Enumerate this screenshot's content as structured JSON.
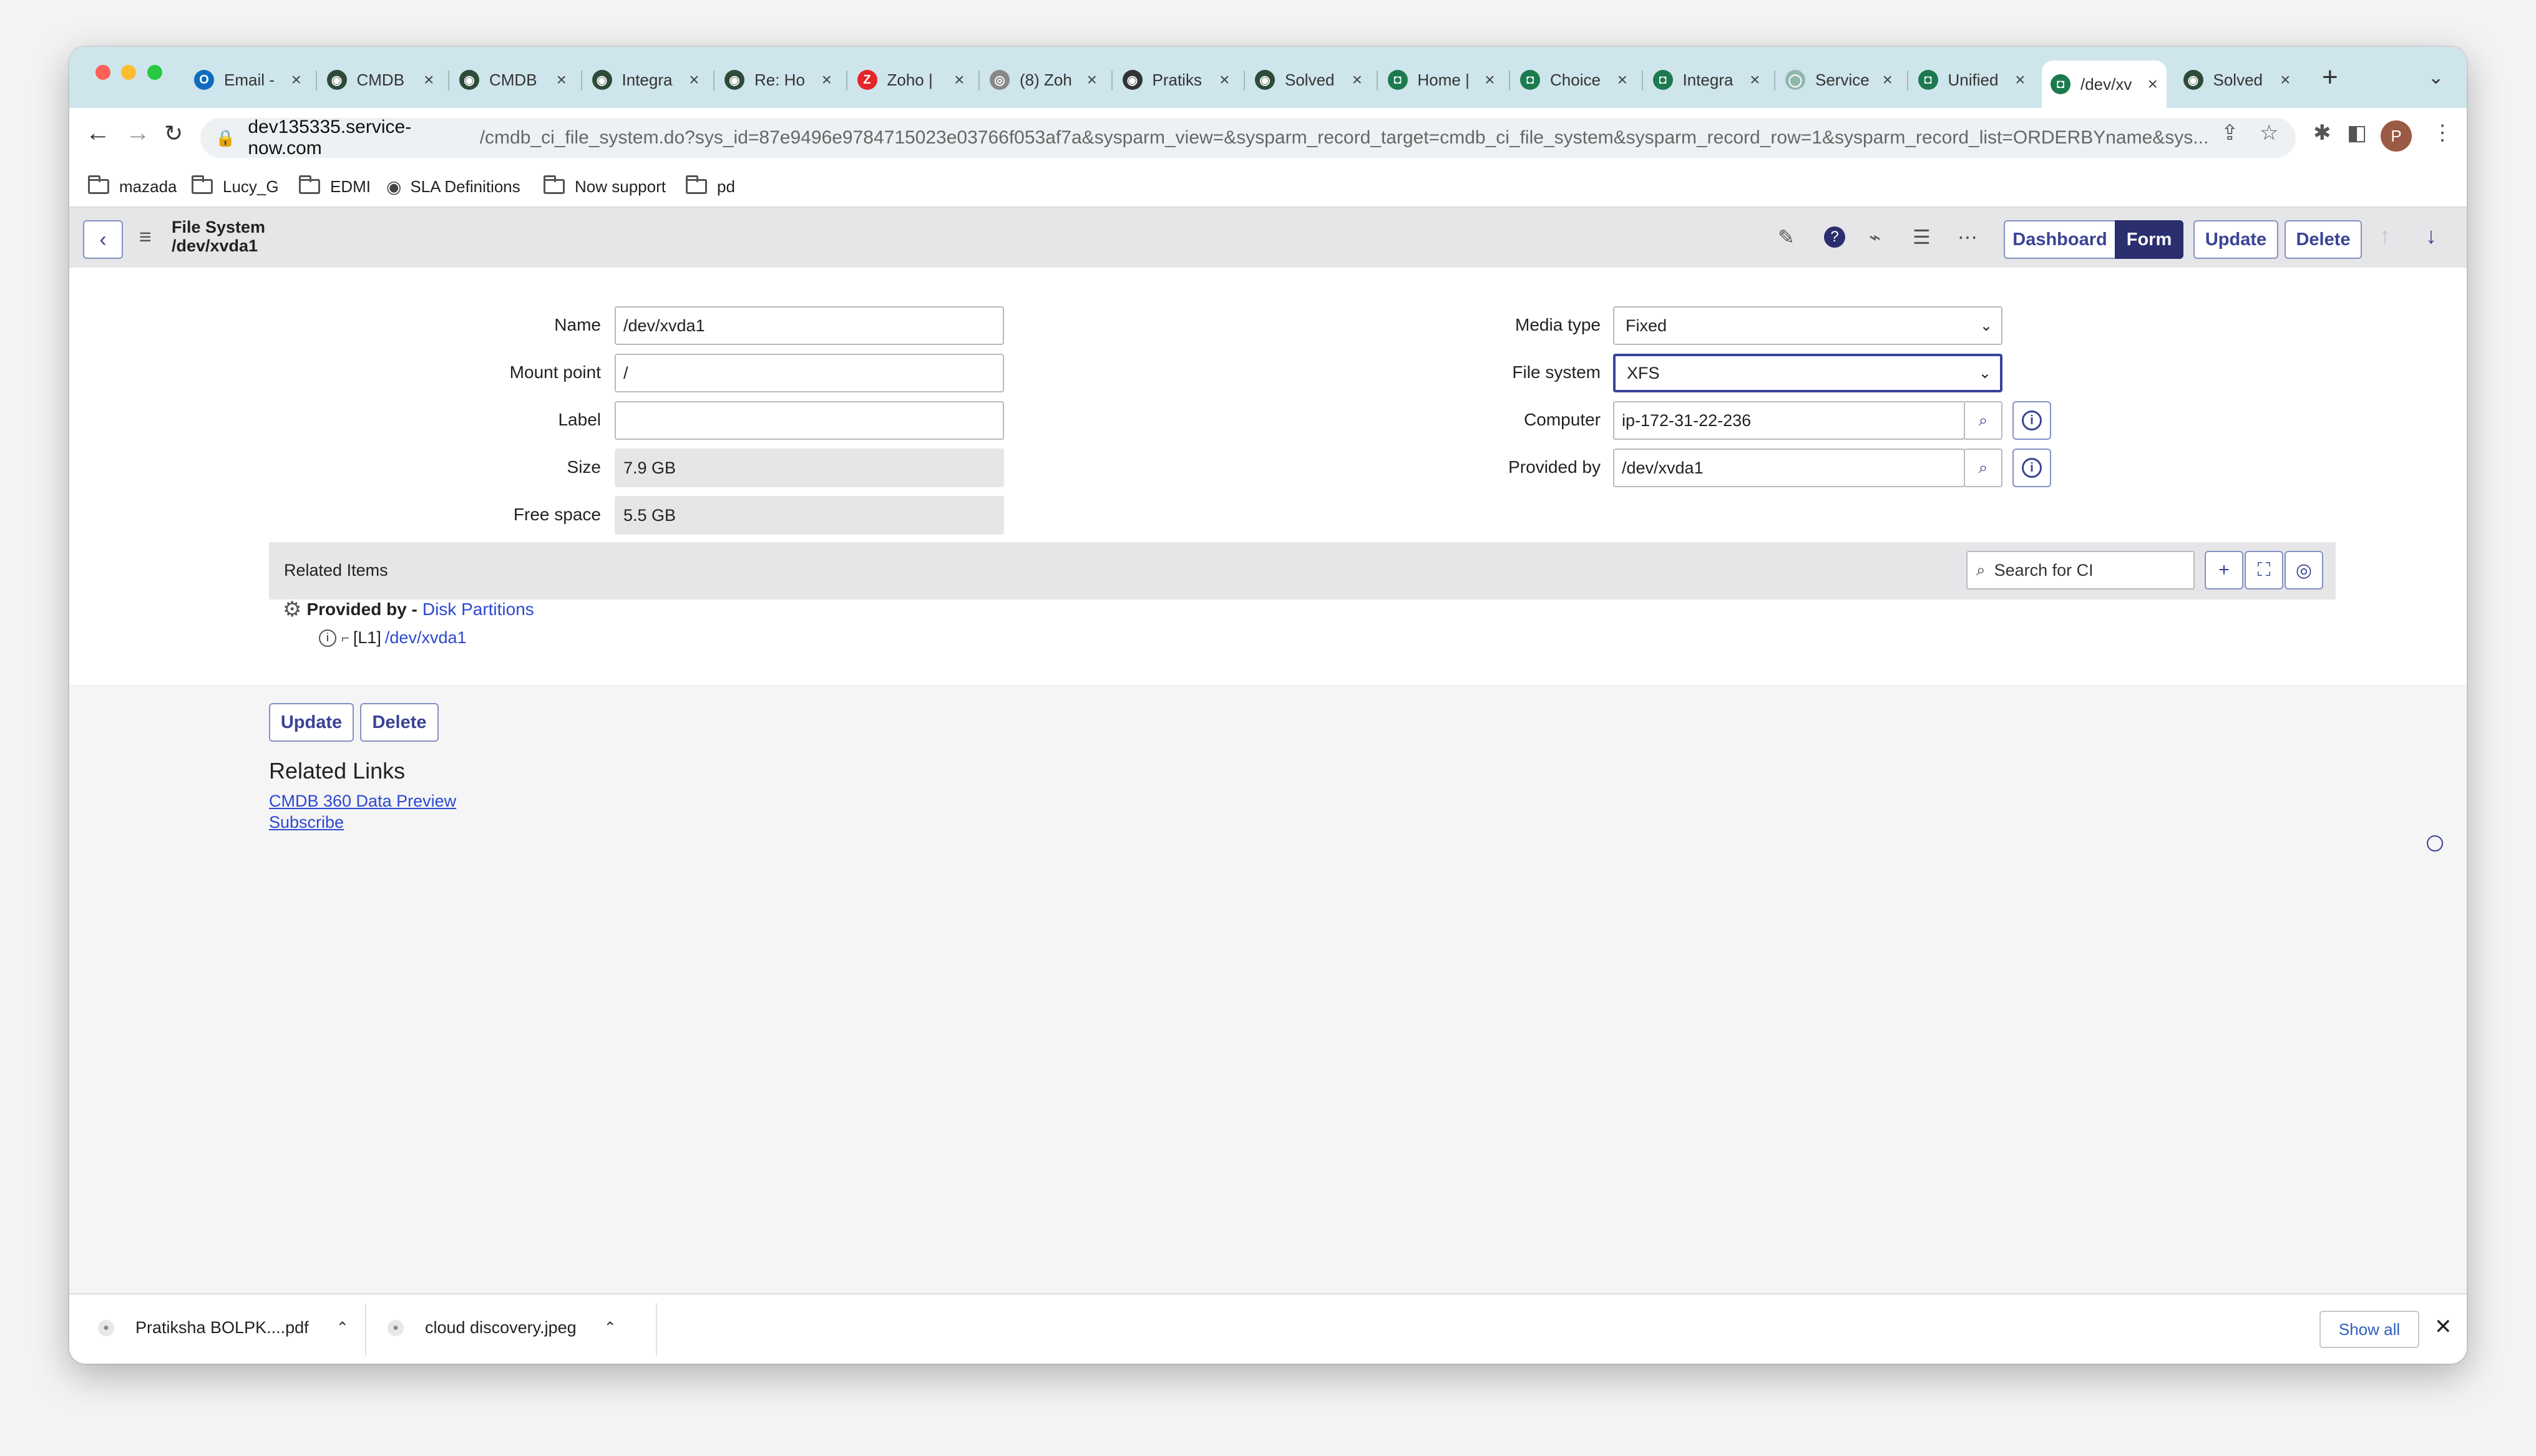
{
  "browser": {
    "tabs": [
      {
        "label": "Email -",
        "fav_color": "#0f6cbd",
        "fav_glyph": "O",
        "icon": "outlook-icon"
      },
      {
        "label": "CMDB",
        "fav_color": "#2e4b3a",
        "fav_glyph": "◉",
        "icon": "servicenow-icon"
      },
      {
        "label": "CMDB",
        "fav_color": "#2e4b3a",
        "fav_glyph": "◉",
        "icon": "servicenow-icon"
      },
      {
        "label": "Integra",
        "fav_color": "#2e4b3a",
        "fav_glyph": "◉",
        "icon": "servicenow-icon"
      },
      {
        "label": "Re: Ho",
        "fav_color": "#2e4b3a",
        "fav_glyph": "◉",
        "icon": "servicenow-icon"
      },
      {
        "label": "Zoho |",
        "fav_color": "#e42527",
        "fav_glyph": "Z",
        "icon": "zoho-icon"
      },
      {
        "label": "(8) Zoh",
        "fav_color": "#888888",
        "fav_glyph": "◎",
        "icon": "zoho-icon"
      },
      {
        "label": "Pratiks",
        "fav_color": "#333333",
        "fav_glyph": "◉",
        "icon": "globe-icon"
      },
      {
        "label": "Solved",
        "fav_color": "#2e4b3a",
        "fav_glyph": "◉",
        "icon": "servicenow-icon"
      },
      {
        "label": "Home |",
        "fav_color": "#1d7a4f",
        "fav_glyph": "◘",
        "icon": "servicenow-now-icon"
      },
      {
        "label": "Choice",
        "fav_color": "#1d7a4f",
        "fav_glyph": "◘",
        "icon": "servicenow-now-icon"
      },
      {
        "label": "Integra",
        "fav_color": "#1d7a4f",
        "fav_glyph": "◘",
        "icon": "servicenow-now-icon"
      },
      {
        "label": "Service",
        "fav_color": "#8fb7ad",
        "fav_glyph": "◯",
        "icon": "servicenow-icon"
      },
      {
        "label": "Unified",
        "fav_color": "#1d7a4f",
        "fav_glyph": "◘",
        "icon": "servicenow-now-icon"
      },
      {
        "label": "/dev/xv",
        "fav_color": "#1d7a4f",
        "fav_glyph": "◘",
        "icon": "servicenow-now-icon",
        "active": true
      },
      {
        "label": "Solved",
        "fav_color": "#2e4b3a",
        "fav_glyph": "◉",
        "icon": "servicenow-icon"
      }
    ],
    "url_host": "dev135335.service-now.com",
    "url_path": "/cmdb_ci_file_system.do?sys_id=87e9496e9784715023e03766f053af7a&sysparm_view=&sysparm_record_target=cmdb_ci_file_system&sysparm_record_row=1&sysparm_record_list=ORDERBYname&sys...",
    "profile_initial": "P",
    "bookmarks": [
      {
        "label": "mazada",
        "type": "folder"
      },
      {
        "label": "Lucy_G",
        "type": "folder"
      },
      {
        "label": "EDMI",
        "type": "folder"
      },
      {
        "label": "SLA Definitions",
        "type": "link"
      },
      {
        "label": "Now support",
        "type": "folder"
      },
      {
        "label": "pd",
        "type": "folder"
      }
    ]
  },
  "header": {
    "record_type": "File System",
    "record_name": "/dev/xvda1",
    "view_dashboard": "Dashboard",
    "view_form": "Form",
    "update": "Update",
    "delete": "Delete"
  },
  "form": {
    "left": [
      {
        "label": "Name",
        "value": "/dev/xvda1",
        "readonly": false
      },
      {
        "label": "Mount point",
        "value": "/",
        "readonly": false
      },
      {
        "label": "Label",
        "value": "",
        "readonly": false
      },
      {
        "label": "Size",
        "value": "7.9 GB",
        "readonly": true
      },
      {
        "label": "Free space",
        "value": "5.5 GB",
        "readonly": true
      }
    ],
    "media_type": {
      "label": "Media type",
      "value": "Fixed"
    },
    "file_system": {
      "label": "File system",
      "value": "XFS"
    },
    "computer": {
      "label": "Computer",
      "value": "ip-172-31-22-236"
    },
    "provided_by": {
      "label": "Provided by",
      "value": "/dev/xvda1"
    }
  },
  "related_items": {
    "title": "Related Items",
    "search_placeholder": "Search for CI",
    "relation_prefix": "Provided by -",
    "relation_link": "Disk Partitions",
    "child_level": "[L1]",
    "child_link": "/dev/xvda1"
  },
  "footer_buttons": {
    "update": "Update",
    "delete": "Delete"
  },
  "related_links": {
    "title": "Related Links",
    "links": [
      "CMDB 360 Data Preview",
      "Subscribe"
    ]
  },
  "downloads": {
    "items": [
      "Pratiksha BOLPK....pdf",
      "cloud discovery.jpeg"
    ],
    "show_all": "Show all"
  },
  "colors": {
    "accent": "#2b2f6e",
    "link": "#2c48d0",
    "tabstrip": "#cfe5ec"
  }
}
